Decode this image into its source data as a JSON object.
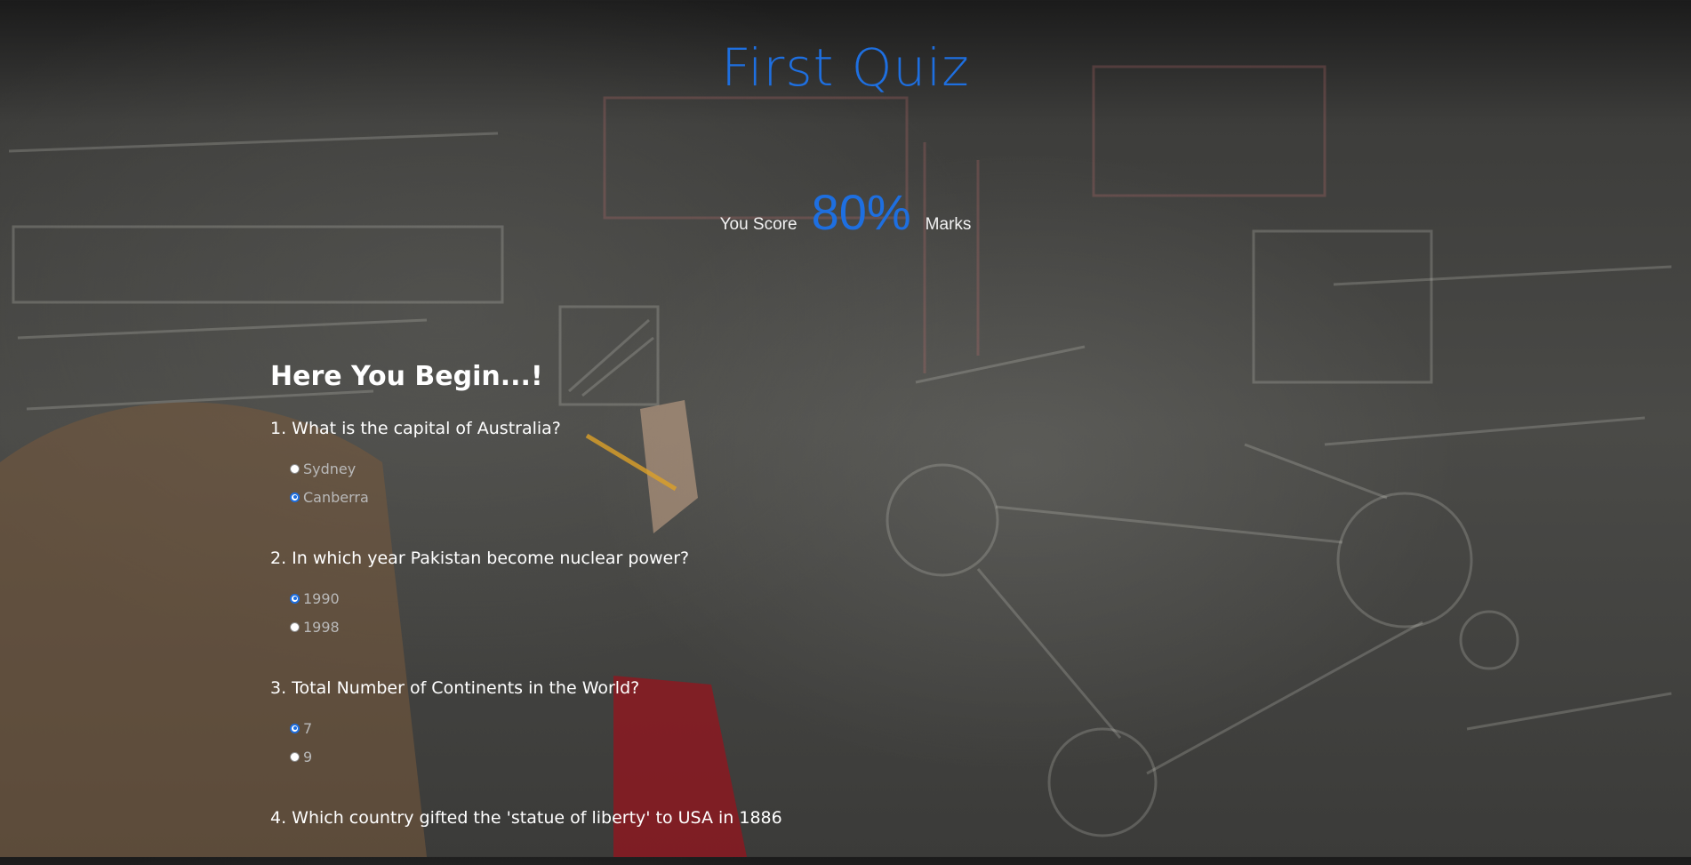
{
  "page": {
    "title": "First Quiz",
    "score_prefix": "You Score",
    "score_value": "80%",
    "score_suffix": "Marks",
    "accent_color": "#1e6fe0",
    "background_image": "woman writing on chalkboard"
  },
  "quiz": {
    "heading": "Here You Begin...!",
    "questions": [
      {
        "text": "1. What is the capital of Australia?",
        "options": [
          {
            "label": "Sydney",
            "selected": false
          },
          {
            "label": "Canberra",
            "selected": true
          }
        ]
      },
      {
        "text": "2. In which year Pakistan become nuclear power?",
        "options": [
          {
            "label": "1990",
            "selected": true
          },
          {
            "label": "1998",
            "selected": false
          }
        ]
      },
      {
        "text": "3. Total Number of Continents in the World?",
        "options": [
          {
            "label": "7",
            "selected": true
          },
          {
            "label": "9",
            "selected": false
          }
        ]
      },
      {
        "text": "4. Which country gifted the 'statue of liberty' to USA in 1886",
        "options": []
      }
    ]
  }
}
